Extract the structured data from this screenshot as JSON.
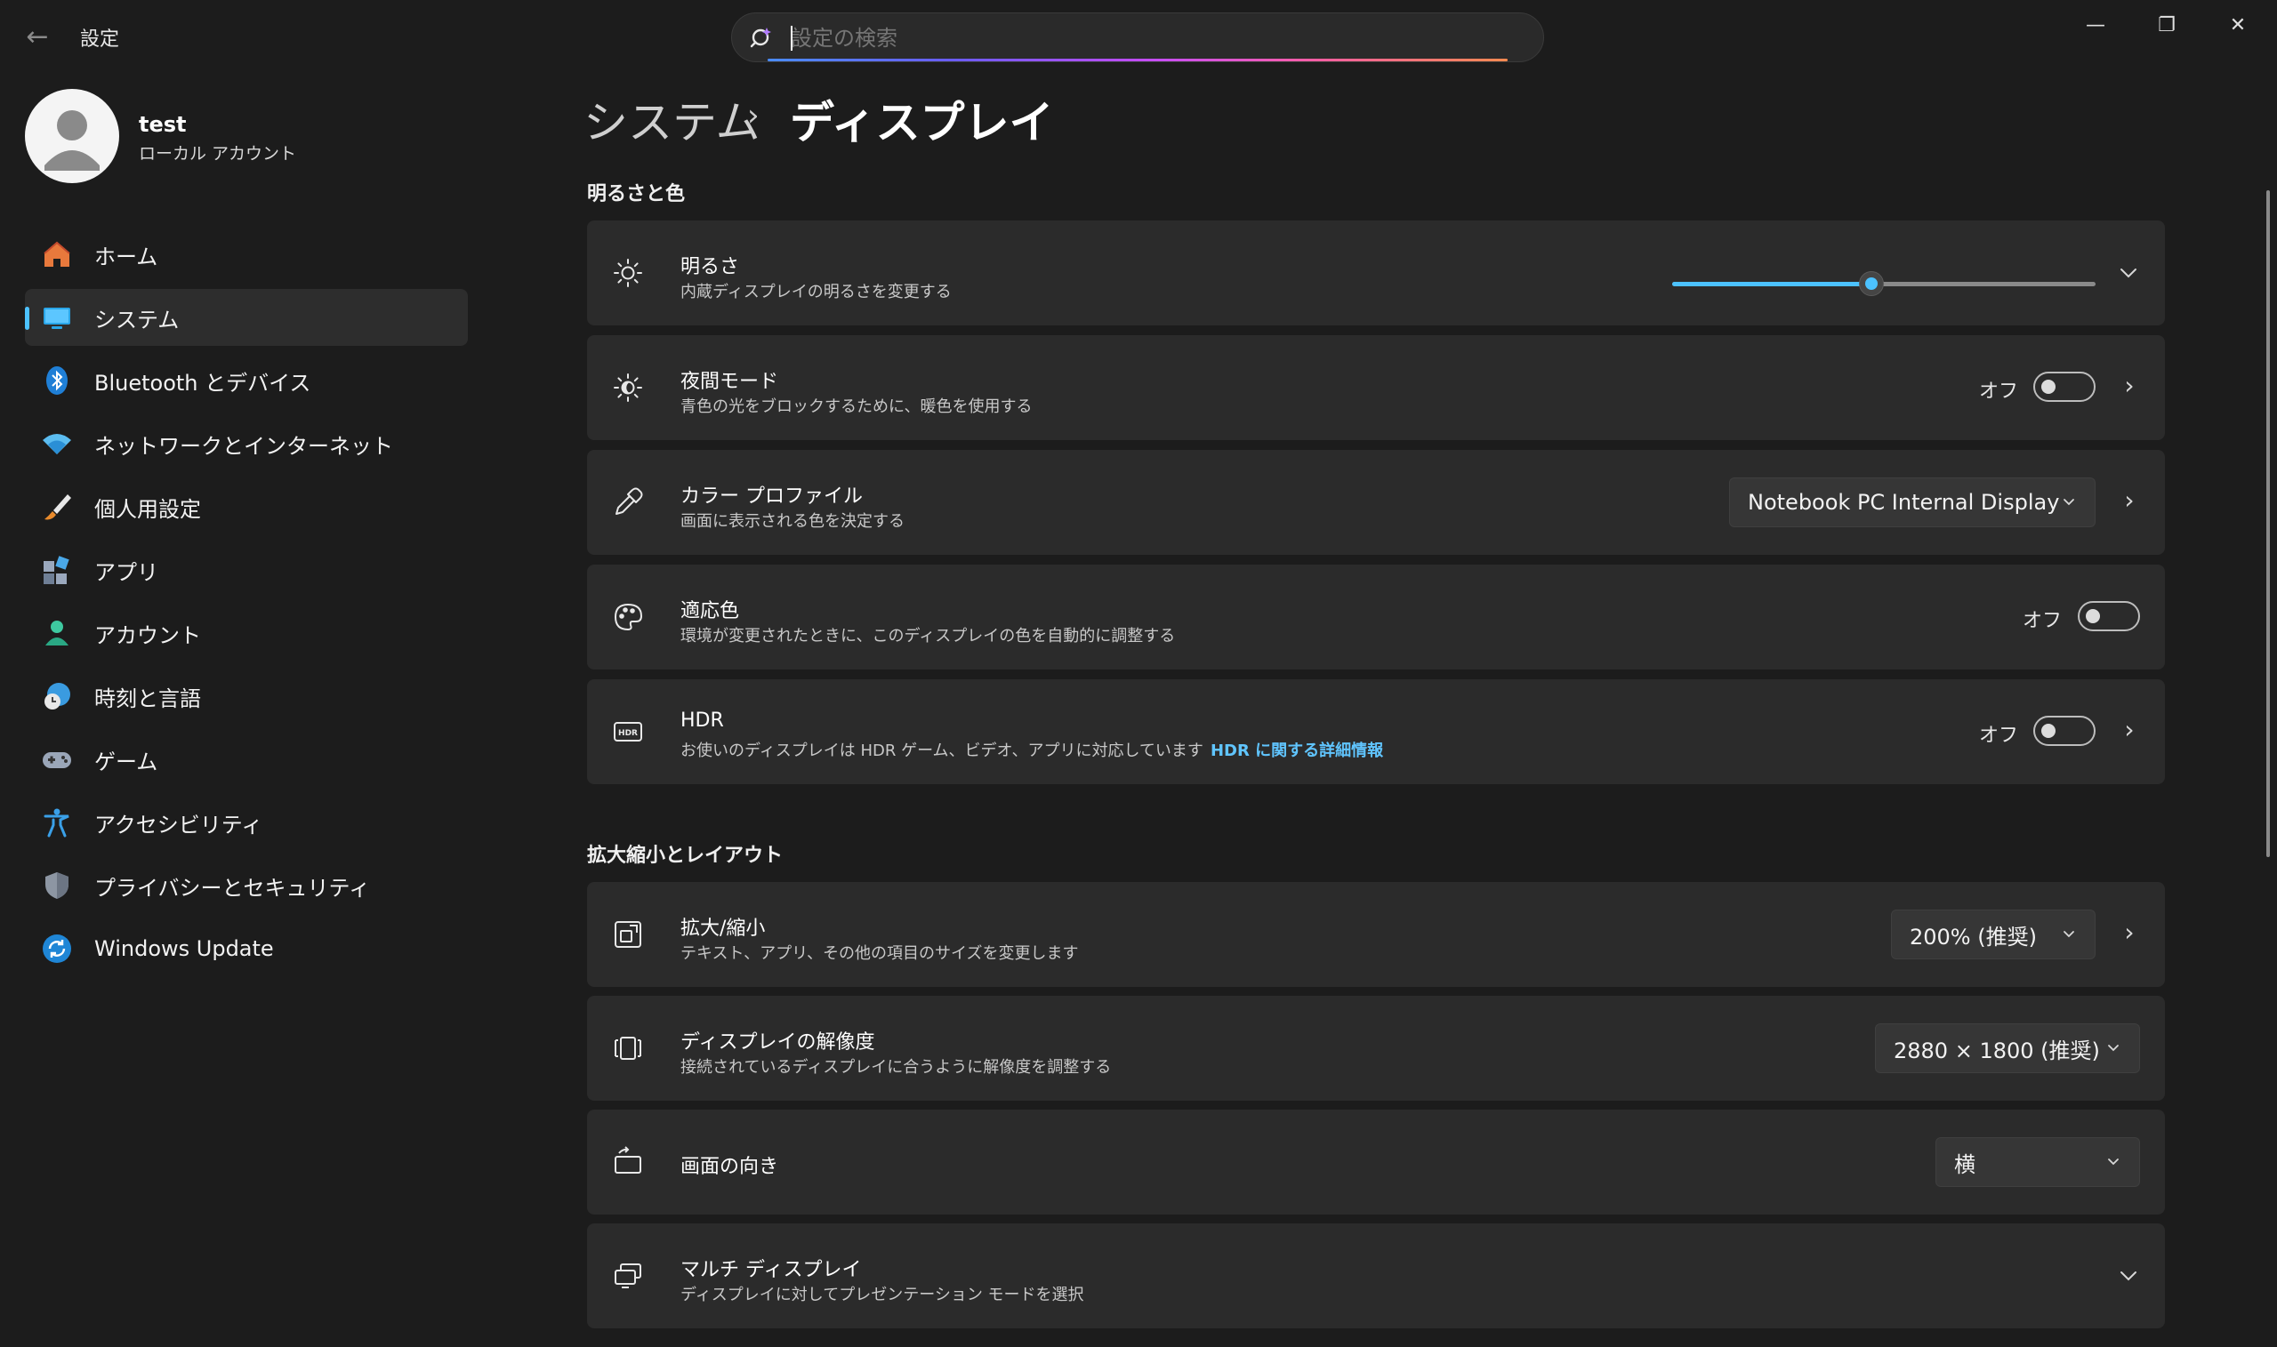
{
  "app": {
    "title": "設定"
  },
  "search": {
    "placeholder": "設定の検索",
    "value": ""
  },
  "window_controls": {
    "minimize": "—",
    "maximize": "❐",
    "close": "✕"
  },
  "user": {
    "name": "test",
    "account_type": "ローカル アカウント"
  },
  "sidebar": {
    "items": [
      {
        "label": "ホーム",
        "icon": "home-icon"
      },
      {
        "label": "システム",
        "icon": "system-icon",
        "selected": true
      },
      {
        "label": "Bluetooth とデバイス",
        "icon": "bluetooth-icon"
      },
      {
        "label": "ネットワークとインターネット",
        "icon": "wifi-icon"
      },
      {
        "label": "個人用設定",
        "icon": "brush-icon"
      },
      {
        "label": "アプリ",
        "icon": "apps-icon"
      },
      {
        "label": "アカウント",
        "icon": "account-icon"
      },
      {
        "label": "時刻と言語",
        "icon": "time-language-icon"
      },
      {
        "label": "ゲーム",
        "icon": "gamepad-icon"
      },
      {
        "label": "アクセシビリティ",
        "icon": "accessibility-icon"
      },
      {
        "label": "プライバシーとセキュリティ",
        "icon": "shield-icon"
      },
      {
        "label": "Windows Update",
        "icon": "windows-update-icon"
      }
    ]
  },
  "breadcrumb": {
    "parent": "システム",
    "separator": "›",
    "current": "ディスプレイ"
  },
  "sections": {
    "brightness_color": {
      "title": "明るさと色",
      "brightness": {
        "title": "明るさ",
        "subtitle": "内蔵ディスプレイの明るさを変更する",
        "value_fraction": 0.47
      },
      "night_light": {
        "title": "夜間モード",
        "subtitle": "青色の光をブロックするために、暖色を使用する",
        "state": "オフ"
      },
      "color_profile": {
        "title": "カラー プロファイル",
        "subtitle": "画面に表示される色を決定する",
        "value": "Notebook PC Internal Display"
      },
      "adaptive_color": {
        "title": "適応色",
        "subtitle": "環境が変更されたときに、このディスプレイの色を自動的に調整する",
        "state": "オフ"
      },
      "hdr": {
        "title": "HDR",
        "subtitle": "お使いのディスプレイは HDR ゲーム、ビデオ、アプリに対応しています",
        "link": "HDR に関する詳細情報",
        "state": "オフ"
      }
    },
    "scale_layout": {
      "title": "拡大縮小とレイアウト",
      "scale": {
        "title": "拡大/縮小",
        "subtitle": "テキスト、アプリ、その他の項目のサイズを変更します",
        "value": "200% (推奨)"
      },
      "resolution": {
        "title": "ディスプレイの解像度",
        "subtitle": "接続されているディスプレイに合うように解像度を調整する",
        "value": "2880 × 1800 (推奨)"
      },
      "orientation": {
        "title": "画面の向き",
        "value": "横"
      },
      "multi_display": {
        "title": "マルチ ディスプレイ",
        "subtitle": "ディスプレイに対してプレゼンテーション モードを選択"
      }
    }
  },
  "colors": {
    "accent": "#4cc2ff",
    "background": "#1c1c1c",
    "card": "#2b2b2b",
    "link": "#60c5ff"
  }
}
